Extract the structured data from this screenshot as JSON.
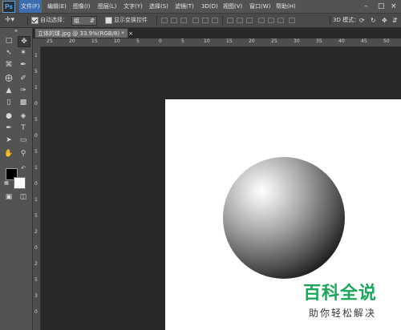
{
  "app": {
    "logo": "Ps"
  },
  "menu": [
    "文件(F)",
    "编辑(E)",
    "图像(I)",
    "图层(L)",
    "文字(Y)",
    "选择(S)",
    "滤镜(T)",
    "3D(D)",
    "视图(V)",
    "窗口(W)",
    "帮助(H)"
  ],
  "options": {
    "auto_select_label": "自动选择：",
    "auto_select_value": "组",
    "show_transform_label": "显示变换控件",
    "mode_3d_label": "3D 模式："
  },
  "document_tab": {
    "title": "立体的球.jpg @ 33.9%(RGB/8) *",
    "close": "×"
  },
  "ruler": {
    "h_ticks": [
      "25",
      "20",
      "15",
      "10",
      "5",
      "0",
      "5",
      "10",
      "15",
      "20",
      "25",
      "30",
      "35",
      "40",
      "45",
      "50"
    ],
    "v_ticks": [
      "1",
      "5",
      "1",
      "0",
      "5",
      "0",
      "5",
      "1",
      "0",
      "1",
      "5",
      "2",
      "0",
      "2",
      "5",
      "3",
      "0"
    ]
  },
  "colors": {
    "foreground": "#000000",
    "background": "#ffffff",
    "menu_active": "#3d6fb0"
  },
  "watermark": {
    "title": "百科全说",
    "subtitle": "助你轻松解决"
  }
}
